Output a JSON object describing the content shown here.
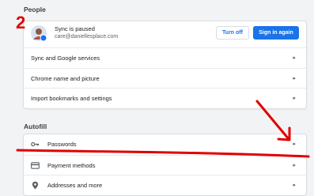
{
  "annotation": {
    "number": "2"
  },
  "people": {
    "title": "People",
    "sync_status": "Sync is paused",
    "email": "care@daniellesplace.com",
    "turn_off_label": "Turn off",
    "sign_in_label": "Sign in again",
    "rows": [
      {
        "label": "Sync and Google services"
      },
      {
        "label": "Chrome name and picture"
      },
      {
        "label": "Import bookmarks and settings"
      }
    ]
  },
  "autofill": {
    "title": "Autofill",
    "rows": [
      {
        "label": "Passwords",
        "icon": "key-icon"
      },
      {
        "label": "Payment methods",
        "icon": "credit-card-icon"
      },
      {
        "label": "Addresses and more",
        "icon": "location-pin-icon"
      }
    ]
  },
  "chevron": "▸",
  "colors": {
    "accent": "#1a73e8",
    "annotation": "#e00000"
  }
}
